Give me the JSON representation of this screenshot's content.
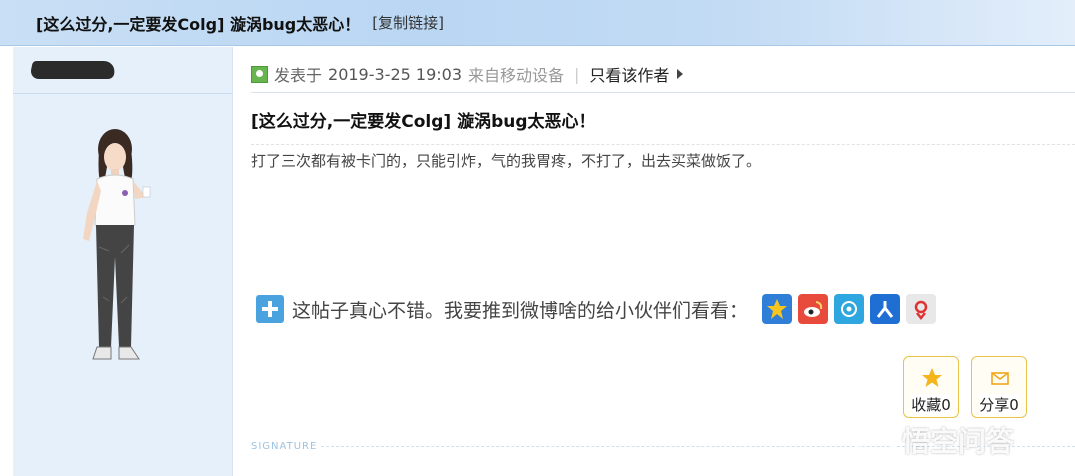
{
  "header": {
    "thread_title": "[这么过分,一定要发Colg] 漩涡bug太恶心！",
    "copy_link_label": "[复制链接]"
  },
  "post": {
    "posted_prefix": "发表于",
    "date": "2019-3-25 19:03",
    "source": "来自移动设备",
    "separator": "|",
    "author_only_label": "只看该作者",
    "title": "[这么过分,一定要发Colg] 漩涡bug太恶心！",
    "body": "打了三次都有被卡门的，只能引炸，气的我胃疼，不打了，出去买菜做饭了。"
  },
  "share": {
    "text": "这帖子真心不错。我要推到微博啥的给小伙伴们看看：",
    "icons": [
      "qzone-icon",
      "sina-weibo-icon",
      "tencent-weibo-icon",
      "renren-icon",
      "other-share-icon"
    ]
  },
  "actions": {
    "favorite_label": "收藏0",
    "share_label": "分享0"
  },
  "signature_label": "SIGNATURE",
  "watermark": "悟空问答",
  "colors": {
    "header_bg": "#c4dcf4",
    "sidebar_bg": "#e5f0fb",
    "action_border": "#e6c44e"
  }
}
